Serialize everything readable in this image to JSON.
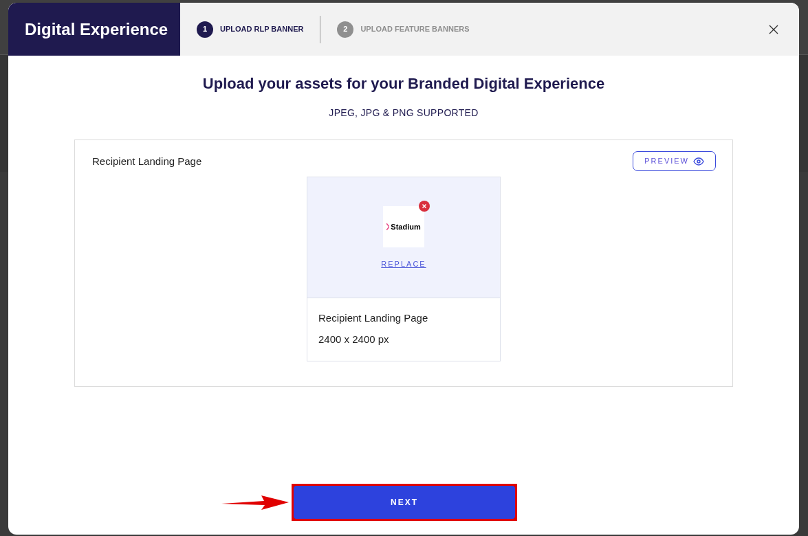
{
  "modal": {
    "title": "Digital Experience",
    "steps": [
      {
        "number": "1",
        "label": "UPLOAD RLP BANNER",
        "selected": true
      },
      {
        "number": "2",
        "label": "UPLOAD FEATURE BANNERS",
        "selected": false
      }
    ],
    "heading": "Upload your assets for your Branded Digital Experience",
    "subheading": "JPEG, JPG & PNG SUPPORTED",
    "panel": {
      "title": "Recipient Landing Page",
      "preview_button": "PREVIEW",
      "asset": {
        "thumbnail_text": "Stadium",
        "replace_link": "REPLACE",
        "name": "Recipient Landing Page",
        "size": "2400 x 2400 px"
      }
    },
    "next_button": "NEXT",
    "next_highlighted": true
  }
}
